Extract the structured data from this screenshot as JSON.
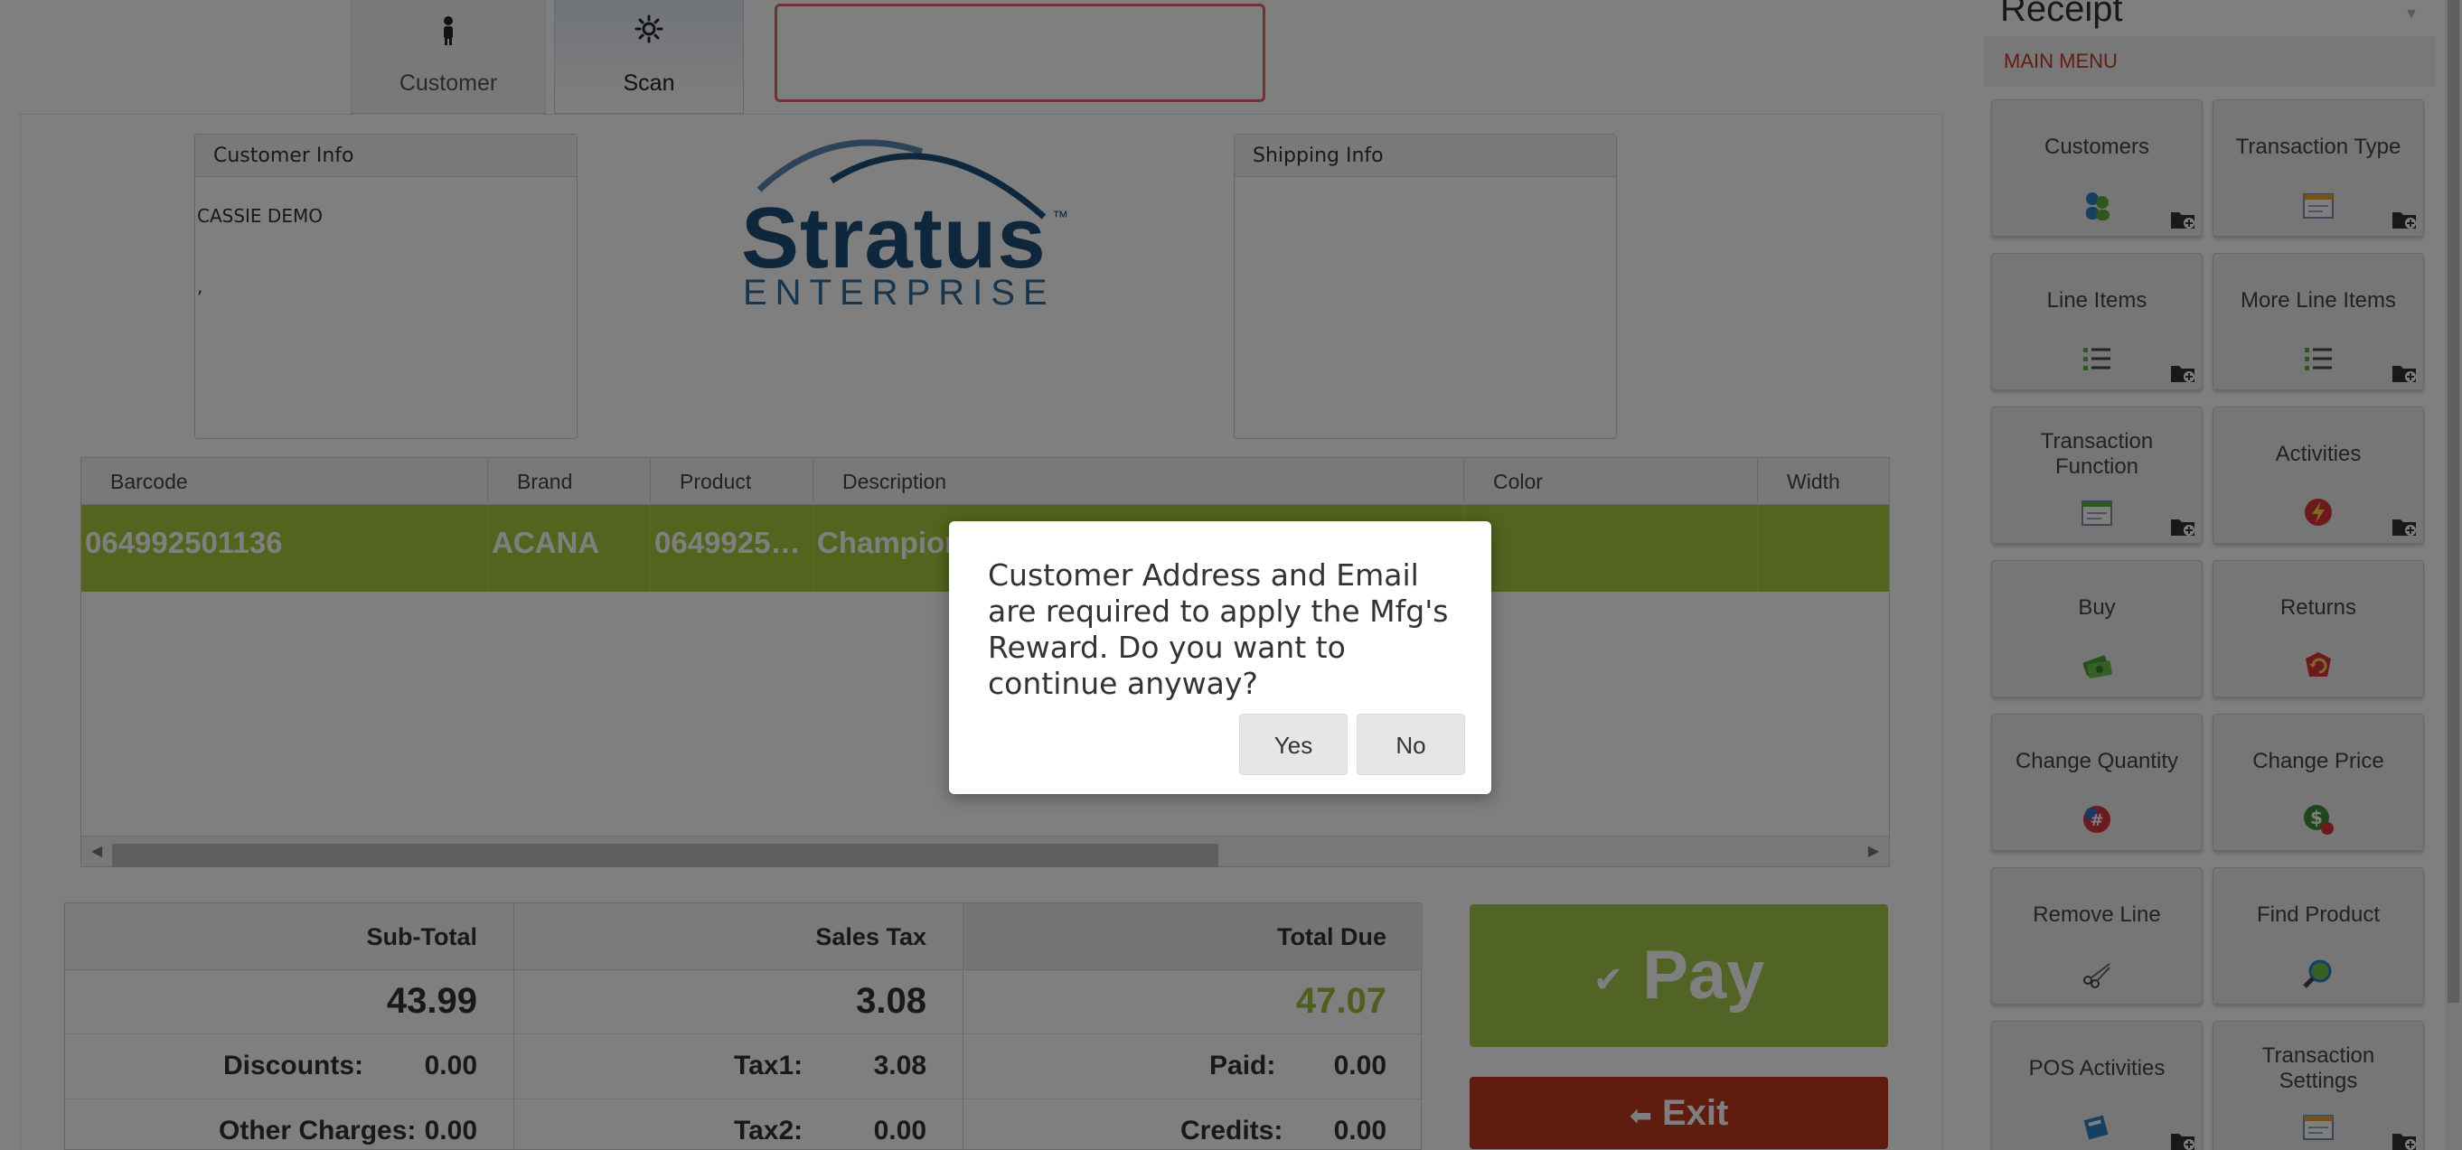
{
  "tabs": [
    {
      "label": "Customer",
      "icon": "person-icon",
      "active": false
    },
    {
      "label": "Scan",
      "icon": "gear-icon",
      "active": true
    }
  ],
  "scan_input": {
    "value": "",
    "placeholder": ""
  },
  "customer_info": {
    "title": "Customer Info",
    "name": "CASSIE DEMO",
    "address_line": ","
  },
  "shipping_info": {
    "title": "Shipping Info"
  },
  "logo": {
    "text": "Stratus",
    "trademark": "™",
    "subtext": "ENTERPRISE"
  },
  "grid": {
    "columns": [
      "Barcode",
      "Brand",
      "Product",
      "Description",
      "Color",
      "Width"
    ],
    "rows": [
      {
        "barcode": "064992501136",
        "brand": "ACANA",
        "product": "0649925…",
        "description": "Champion",
        "color": "",
        "width": ""
      }
    ]
  },
  "totals": {
    "subtotal": {
      "label": "Sub-Total",
      "value": "43.99"
    },
    "sales_tax": {
      "label": "Sales Tax",
      "value": "3.08"
    },
    "total_due": {
      "label": "Total Due",
      "value": "47.07"
    },
    "discounts": {
      "label": "Discounts:",
      "value": "0.00"
    },
    "other_charges": {
      "label": "Other Charges:",
      "value": "0.00"
    },
    "tax1": {
      "label": "Tax1:",
      "value": "3.08"
    },
    "tax2": {
      "label": "Tax2:",
      "value": "0.00"
    },
    "paid": {
      "label": "Paid:",
      "value": "0.00"
    },
    "credits": {
      "label": "Credits:",
      "value": "0.00"
    }
  },
  "actions": {
    "pay_label": "Pay",
    "exit_label": "Exit"
  },
  "sidebar": {
    "title": "Receipt",
    "menu_label": "MAIN MENU",
    "buttons": [
      {
        "label": "Customers",
        "icon": "people-icon"
      },
      {
        "label": "Transaction Type",
        "icon": "window-icon"
      },
      {
        "label": "Line Items",
        "icon": "list-icon"
      },
      {
        "label": "More Line Items",
        "icon": "list-icon"
      },
      {
        "label": "Transaction Function",
        "icon": "window-icon"
      },
      {
        "label": "Activities",
        "icon": "lightning-icon"
      },
      {
        "label": "Buy",
        "icon": "money-icon"
      },
      {
        "label": "Returns",
        "icon": "return-icon"
      },
      {
        "label": "Change Quantity",
        "icon": "number-icon"
      },
      {
        "label": "Change Price",
        "icon": "price-icon"
      },
      {
        "label": "Remove Line",
        "icon": "scissors-icon"
      },
      {
        "label": "Find Product",
        "icon": "magnifier-icon"
      },
      {
        "label": "POS Activities",
        "icon": "pos-icon"
      },
      {
        "label": "Transaction Settings",
        "icon": "window-icon"
      }
    ]
  },
  "modal": {
    "message": "Customer Address and Email are required to apply the Mfg's Reward. Do you want to continue anyway?",
    "yes_label": "Yes",
    "no_label": "No"
  },
  "colors": {
    "row_highlight": "#a4c93b",
    "pay": "#a5c94a",
    "exit": "#c0391c",
    "menu_accent": "#c0392b",
    "logo_blue": "#1d4f7a"
  }
}
